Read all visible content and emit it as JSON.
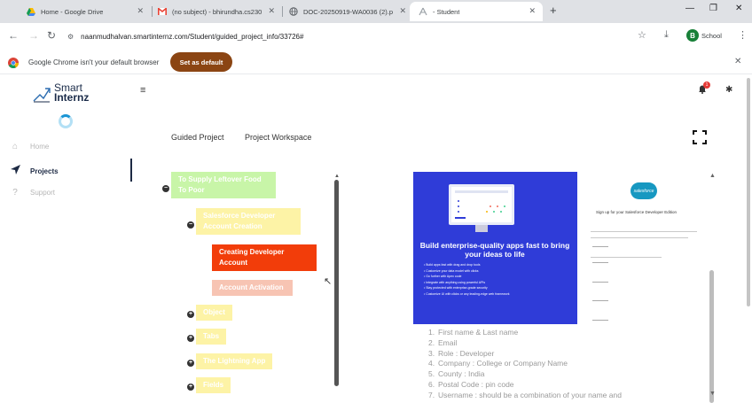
{
  "browser": {
    "tabs": [
      {
        "title": "Home - Google Drive",
        "icon": "google-drive-icon"
      },
      {
        "title": "(no subject) - bhirundha.cs230",
        "icon": "gmail-icon"
      },
      {
        "title": "DOC-20250919-WA0036 (2).p",
        "icon": "globe-icon"
      },
      {
        "title": "- Student",
        "icon": "site-icon"
      }
    ],
    "url": "naanmudhalvan.smartinternz.com/Student/guided_project_info/33726#",
    "profile_label": "School",
    "profile_initial": "B",
    "infobar_message": "Google Chrome isn't your default browser",
    "infobar_button": "Set as default"
  },
  "app": {
    "logo_line1": "Smart",
    "logo_line2": "Internz",
    "nav": [
      {
        "label": "Home",
        "icon": "home-icon"
      },
      {
        "label": "Projects",
        "icon": "send-icon"
      },
      {
        "label": "Support",
        "icon": "question-icon"
      }
    ],
    "notification_count": "1",
    "tabs": [
      "Guided Project",
      "Project Workspace"
    ]
  },
  "tree": {
    "root": "To Supply Leftover Food To Poor",
    "child": "Salesforce Developer Account Creation",
    "selected": "Creating Developer Account",
    "sibling": "Account Activation",
    "others": [
      "Object",
      "Tabs",
      "The Lightning App",
      "Fields"
    ]
  },
  "promo": {
    "headline": "Build enterprise-quality apps fast to bring your ideas to life",
    "bullets": [
      "Build apps fast with drag and drop tools",
      "Customize your data model with clicks",
      "Go further with Apex code",
      "Integrate with anything using powerful APIs",
      "Stay protected with enterprise-grade security",
      "Customize UI with clicks or any leading-edge web framework"
    ]
  },
  "signup": {
    "logo": "salesforce",
    "title": "Sign up for your Salesforce Developer Edition"
  },
  "steps": [
    {
      "num": "1.",
      "text": "First name & Last name"
    },
    {
      "num": "2.",
      "text": "Email"
    },
    {
      "num": "3.",
      "text": "Role : Developer"
    },
    {
      "num": "4.",
      "text": "Company : College or Company Name"
    },
    {
      "num": "5.",
      "text": "County : India"
    },
    {
      "num": "6.",
      "text": "Postal Code : pin code"
    },
    {
      "num": "7.",
      "text": "Username : should be a combination of your name and"
    }
  ]
}
